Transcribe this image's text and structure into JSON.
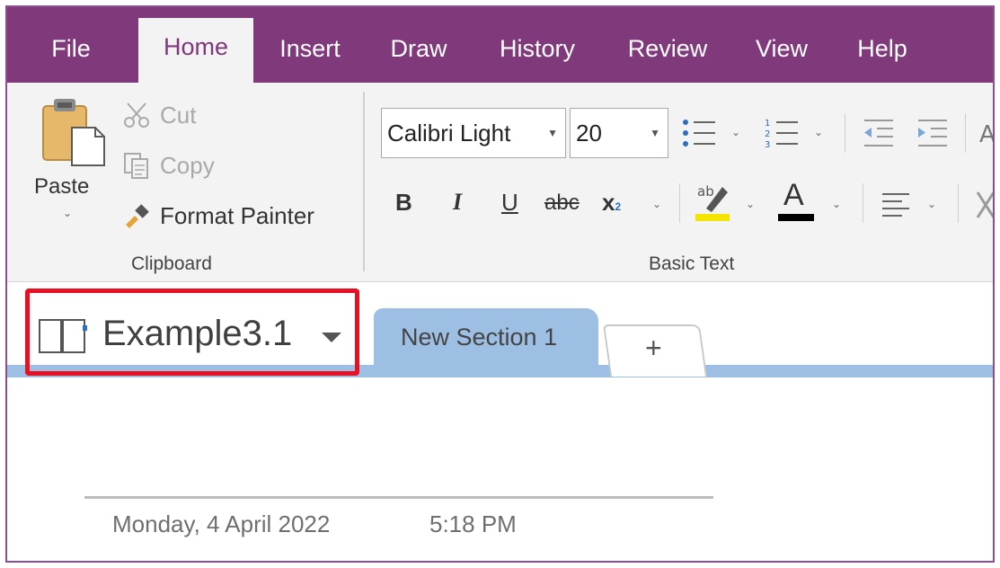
{
  "menu": {
    "tabs": [
      "File",
      "Home",
      "Insert",
      "Draw",
      "History",
      "Review",
      "View",
      "Help"
    ],
    "active_tab": "Home"
  },
  "clipboard": {
    "paste_label": "Paste",
    "cut_label": "Cut",
    "copy_label": "Copy",
    "format_painter_label": "Format Painter",
    "group_label": "Clipboard"
  },
  "basic_text": {
    "font_name": "Calibri Light",
    "font_size": "20",
    "bold": "B",
    "italic": "I",
    "underline": "U",
    "strikethrough": "abc",
    "subscript": "x",
    "subscript_mark": "2",
    "highlight_glyph": "ab",
    "font_color_glyph": "A",
    "group_label": "Basic Text"
  },
  "icons": {
    "highlight_color": "#f5e400",
    "font_color": "#000000"
  },
  "notebook": {
    "name": "Example3.1",
    "highlight_color": "#e81123"
  },
  "sections": {
    "items": [
      "New Section 1"
    ],
    "add_label": "+"
  },
  "page": {
    "date": "Monday, 4 April 2022",
    "time": "5:18 PM"
  },
  "colors": {
    "accent": "#80397b",
    "section_tab": "#9dbfe3"
  }
}
